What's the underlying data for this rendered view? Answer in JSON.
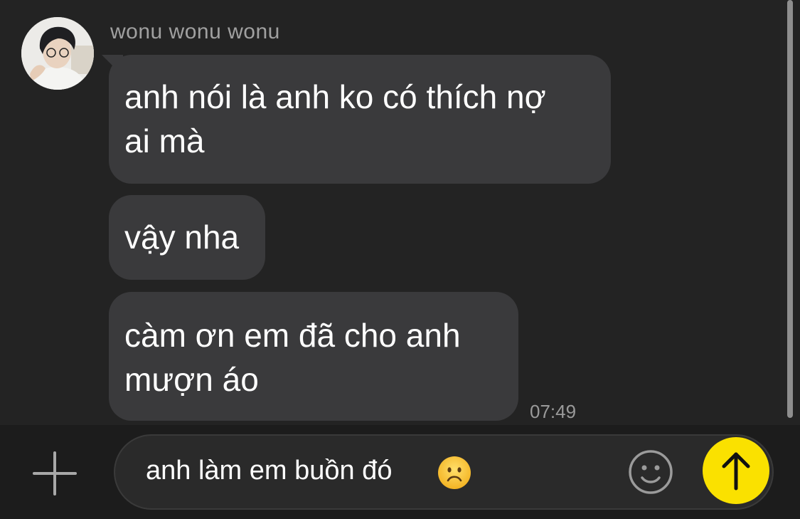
{
  "conversation": {
    "sender_name": "wonu wonu wonu",
    "messages": [
      {
        "line1": "anh nói là anh ko có thích nợ",
        "line2": "ai mà"
      },
      {
        "line1": "vậy nha"
      },
      {
        "line1": "càm ơn em đã cho anh",
        "line2": "mượn áo"
      }
    ],
    "last_timestamp": "07:49"
  },
  "composer": {
    "draft_text": "anh làm em buồn đó",
    "draft_emoji": "sad-face",
    "send_color": "#fae100"
  },
  "colors": {
    "background": "#232323",
    "bubble": "#3a3a3c",
    "accent": "#fae100"
  }
}
